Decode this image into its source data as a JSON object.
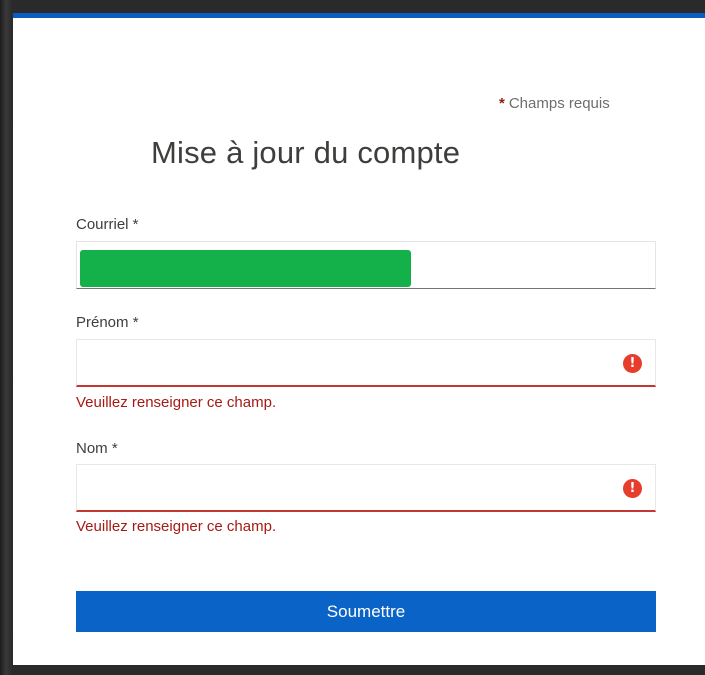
{
  "required_note": {
    "star": "*",
    "text": "Champs requis"
  },
  "title": "Mise à jour du compte",
  "fields": {
    "email": {
      "label": "Courriel *",
      "value": ""
    },
    "first_name": {
      "label": "Prénom *",
      "value": "",
      "error": "Veuillez renseigner ce champ."
    },
    "last_name": {
      "label": "Nom *",
      "value": "",
      "error": "Veuillez renseigner ce champ."
    }
  },
  "error_icon_glyph": "!",
  "submit_label": "Soumettre",
  "colors": {
    "accent": "#0a64c8",
    "error": "#c23934",
    "redaction": "#14b14b"
  }
}
